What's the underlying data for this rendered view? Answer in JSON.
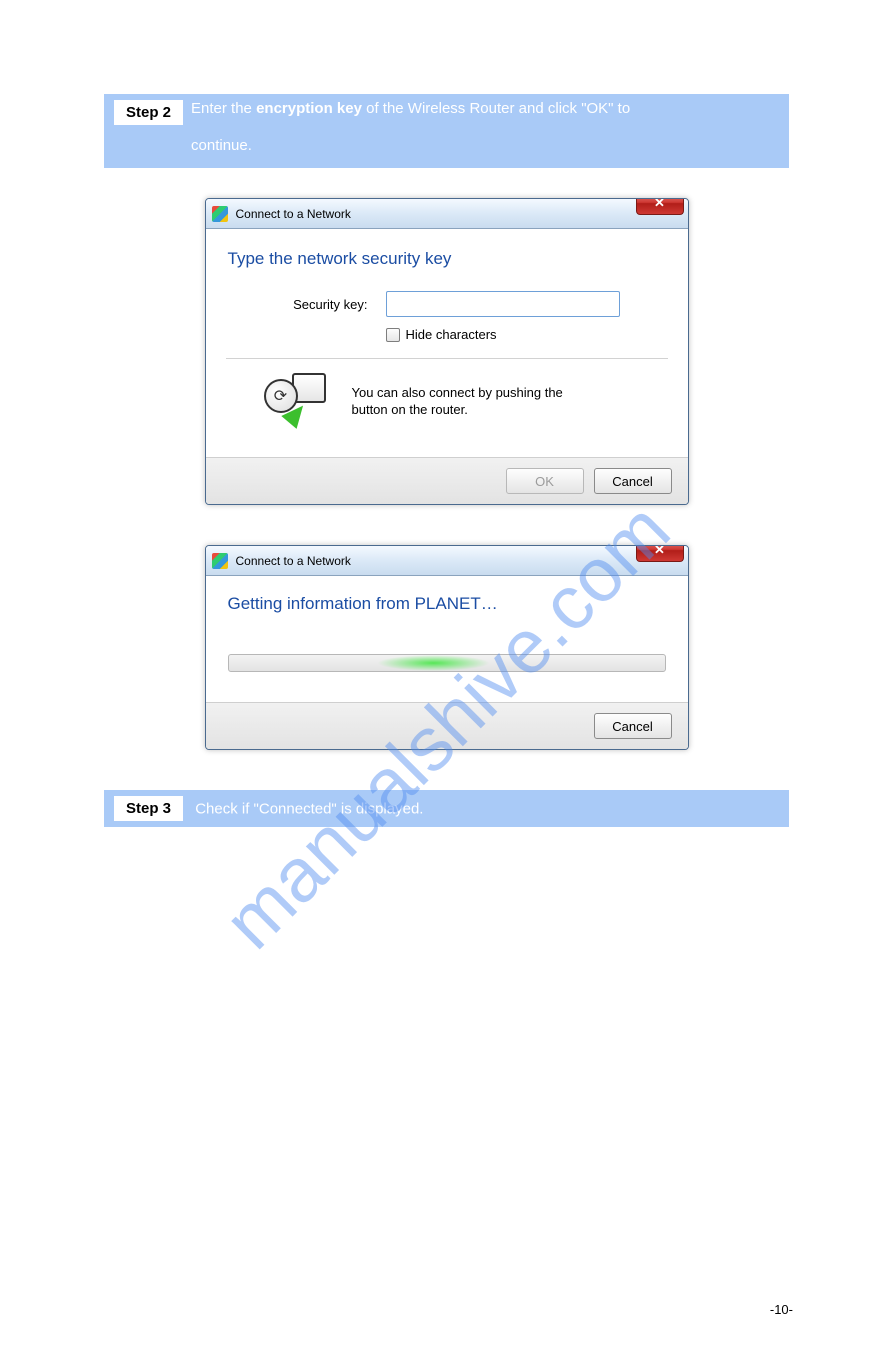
{
  "watermark": "manualshive.com",
  "steps": {
    "step2": {
      "label": "Step 2",
      "text_line1": "Enter the ",
      "bold": "encryption key",
      "text_line2": " of the Wireless Router and click \"OK\" to",
      "text_line3": "continue."
    },
    "step3": {
      "label": "Step 3",
      "text": "Check if \"Connected\" is displayed."
    }
  },
  "dialog1": {
    "title": "Connect to a Network",
    "heading": "Type the network security key",
    "sec_label": "Security key:",
    "sec_value": "",
    "hide_label": "Hide characters",
    "hint_line1": "You can also connect by pushing the",
    "hint_line2": "button on the router.",
    "ok": "OK",
    "cancel": "Cancel"
  },
  "dialog2": {
    "title": "Connect to a Network",
    "heading": "Getting information from PLANET…",
    "cancel": "Cancel"
  },
  "page_number": "-10-"
}
